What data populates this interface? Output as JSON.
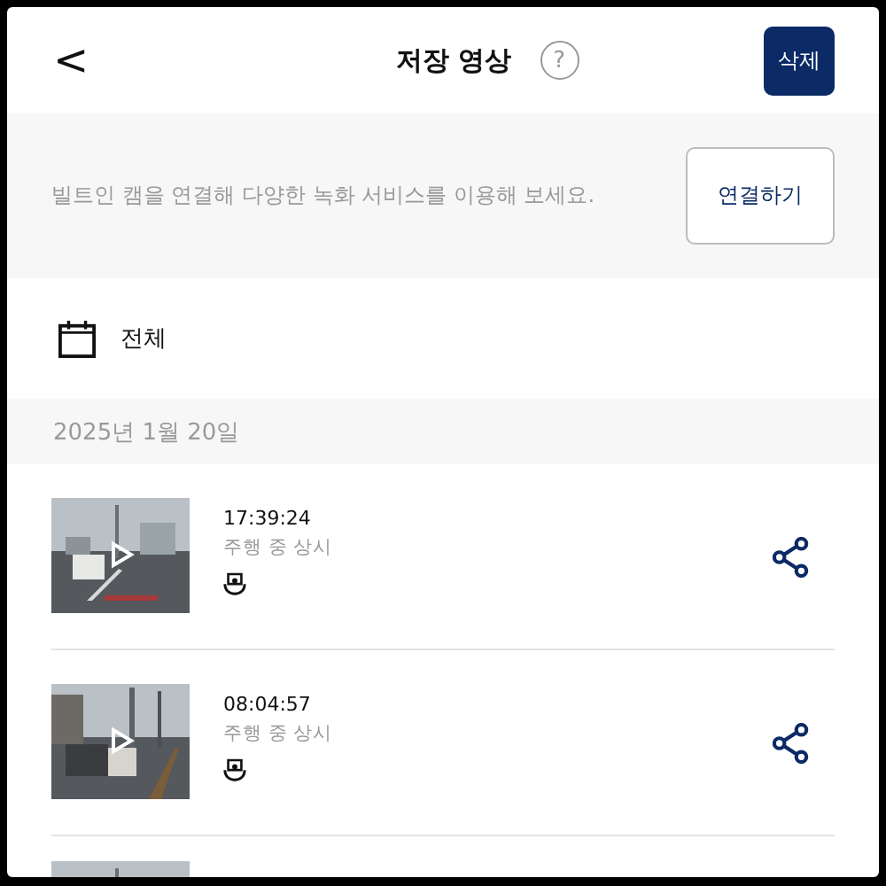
{
  "header": {
    "back": "<",
    "title": "저장 영상",
    "help": "?",
    "delete_button": "삭제"
  },
  "banner": {
    "text": "빌트인 캠을 연결해 다양한 녹화 서비스를 이용해 보세요.",
    "button": "연결하기"
  },
  "filter": {
    "label": "전체"
  },
  "date_header": "2025년 1월 20일",
  "videos": [
    {
      "time": "17:39:24",
      "mode": "주행 중 상시",
      "driver_icon": true
    },
    {
      "time": "08:04:57",
      "mode": "주행 중 상시",
      "driver_icon": true
    }
  ]
}
